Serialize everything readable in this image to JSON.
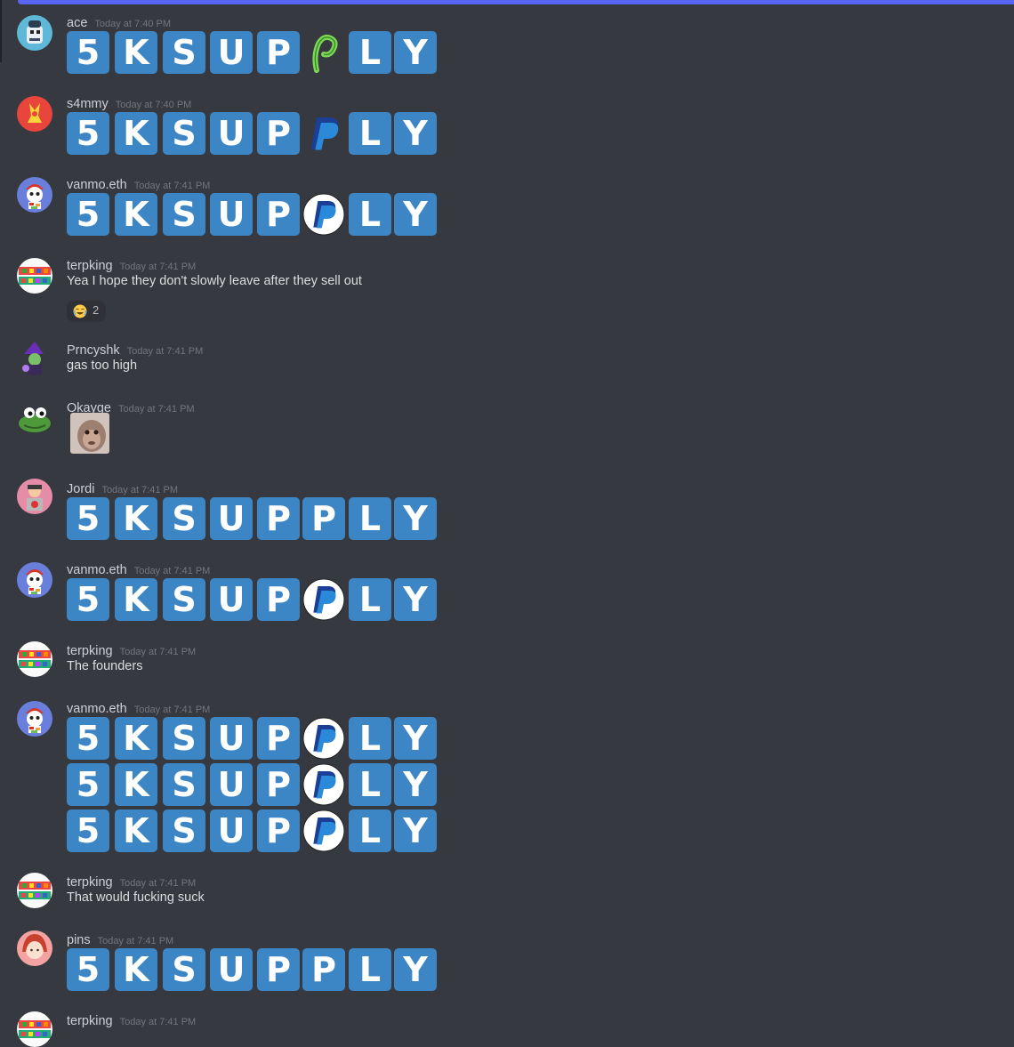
{
  "theme": {
    "background": "#36393f",
    "accent": "#5865f2",
    "emoji_tile": "#3d86c6"
  },
  "emote_letters": [
    "5",
    "K",
    "S",
    "U",
    "P",
    "P",
    "L",
    "Y"
  ],
  "messages": [
    {
      "username": "ace",
      "timestamp": "Today at 7:40 PM",
      "content": "emote-row",
      "sixth_emote": "green-p-emote"
    },
    {
      "username": "s4mmy",
      "timestamp": "Today at 7:40 PM",
      "content": "emote-row",
      "sixth_emote": "paypal-emote"
    },
    {
      "username": "vanmo.eth",
      "timestamp": "Today at 7:41 PM",
      "content": "emote-row",
      "sixth_emote": "paypal-circle-emote"
    },
    {
      "username": "terpking",
      "timestamp": "Today at 7:41 PM",
      "text": "Yea I hope they don't slowly leave after they sell out",
      "reaction": {
        "emoji": "joy-emoji",
        "count": "2"
      }
    },
    {
      "username": "Prncyshk",
      "timestamp": "Today at 7:41 PM",
      "text": "gas too high"
    },
    {
      "username": "Okayge",
      "timestamp": "Today at 7:41 PM",
      "content": "monkey-gif"
    },
    {
      "username": "Jordi",
      "timestamp": "Today at 7:41 PM",
      "content": "emote-row",
      "sixth_emote": "letter-p"
    },
    {
      "username": "vanmo.eth",
      "timestamp": "Today at 7:41 PM",
      "content": "emote-row",
      "sixth_emote": "paypal-circle-emote"
    },
    {
      "username": "terpking",
      "timestamp": "Today at 7:41 PM",
      "text": "The founders"
    },
    {
      "username": "vanmo.eth",
      "timestamp": "Today at 7:41 PM",
      "content": "emote-row x3",
      "sixth_emote": "paypal-circle-emote"
    },
    {
      "username": "terpking",
      "timestamp": "Today at 7:41 PM",
      "text": "That would fucking suck"
    },
    {
      "username": "pins",
      "timestamp": "Today at 7:41 PM",
      "content": "emote-row",
      "sixth_emote": "letter-p"
    },
    {
      "username": "terpking",
      "timestamp": "Today at 7:41 PM"
    }
  ]
}
